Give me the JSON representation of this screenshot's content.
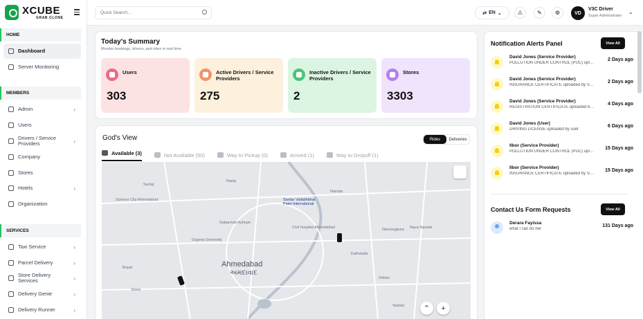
{
  "brand": {
    "name": "XCUBE",
    "tagline": "GRAB CLONE"
  },
  "sidebar": {
    "sections": [
      "HOME",
      "MEMBERS",
      "SERVICES"
    ],
    "home": [
      {
        "label": "Dashboard",
        "icon": "dashboard-icon"
      },
      {
        "label": "Server Monitoring",
        "icon": "monitor-icon"
      }
    ],
    "members": [
      {
        "label": "Admin",
        "icon": "admin-icon"
      },
      {
        "label": "Users",
        "icon": "users-icon"
      },
      {
        "label": "Drivers / Service Providers",
        "icon": "driver-icon"
      },
      {
        "label": "Company",
        "icon": "company-icon"
      },
      {
        "label": "Stores",
        "icon": "store-icon"
      },
      {
        "label": "Hotels",
        "icon": "hotel-icon"
      },
      {
        "label": "Organization",
        "icon": "organization-icon"
      }
    ],
    "services": [
      {
        "label": "Taxi Service",
        "icon": "taxi-icon"
      },
      {
        "label": "Parcel Delivery",
        "icon": "parcel-icon"
      },
      {
        "label": "Store Delivery Services",
        "icon": "store-delivery-icon"
      },
      {
        "label": "Delivery Genie",
        "icon": "genie-icon"
      },
      {
        "label": "Delivery Runner",
        "icon": "runner-icon"
      }
    ]
  },
  "topbar": {
    "search_placeholder": "Quick Search...",
    "language": "EN",
    "user": {
      "initials": "VD",
      "name": "V3C Driver",
      "role": "Super Administrator"
    }
  },
  "summary": {
    "title": "Today's Summary",
    "subtitle": "Monitor bookings, drivers, and rides in real time.",
    "stats": [
      {
        "label": "Users",
        "value": "303",
        "bg": "#fde2e4",
        "accent": "#ec6b86"
      },
      {
        "label": "Active Drivers / Service Providers",
        "value": "275",
        "bg": "#fdf0dc",
        "accent": "#f0956c"
      },
      {
        "label": "Inactive Drivers / Service Providers",
        "value": "2",
        "bg": "#dcf5e2",
        "accent": "#4ec47a"
      },
      {
        "label": "Stores",
        "value": "3303",
        "bg": "#efe4fb",
        "accent": "#b57ef0"
      }
    ]
  },
  "gods_view": {
    "title": "God's View",
    "toggle": [
      "Rides",
      "Deliveries"
    ],
    "tabs": [
      "Available (3)",
      "Not Available (50)",
      "Way to Pickup (0)",
      "Arrived (1)",
      "Way to Dropoff (1)"
    ],
    "map": {
      "city": "Ahmedabad",
      "city_local": "અમદાવાદ",
      "labels": [
        "Santej",
        "Ranip",
        "Naroda",
        "Sardar Vallabhbhai Patel International",
        "Navrangpura",
        "Sabarmati Ashram",
        "Gujarat University",
        "Civil hospital Ahmedabad",
        "Kathwada",
        "Bopal",
        "Shela",
        "Science City Ahmedabad",
        "Odhav",
        "Vastral",
        "Nava Naroda"
      ]
    }
  },
  "notifications": {
    "title": "Notification Alerts Panel",
    "view_all": "View All",
    "items": [
      {
        "name": "David Jones (Service Provider)",
        "message": "POLLUTION UNDER CONTROL (PUC) uploaded by Service Provider",
        "time": "2 Days ago"
      },
      {
        "name": "David Jones (Service Provider)",
        "message": "INSURANCE CERTIFICATE uploaded by Service Provider",
        "time": "2 Days ago"
      },
      {
        "name": "David Jones (Service Provider)",
        "message": "REGISTRATION CERTIFICATE uploaded by Service Provider",
        "time": "4 Days ago"
      },
      {
        "name": "David Jones (User)",
        "message": "DRIVING LICENSE uploaded by user",
        "time": "6 Days ago"
      },
      {
        "name": "Ilbor (Service Provider)",
        "message": "POLLUTION UNDER CONTROL (PUC) uploaded by Service Provider",
        "time": "15 Days ago"
      },
      {
        "name": "Ilbor (Service Provider)",
        "message": "INSURANCE CERTIFICATE uploaded by Service Provider",
        "time": "15 Days ago"
      }
    ]
  },
  "contact": {
    "title": "Contact Us Form Requests",
    "view_all": "View All",
    "items": [
      {
        "name": "Derara Fayissa",
        "message": "what I can do her",
        "time": "131 Days ago"
      }
    ]
  }
}
